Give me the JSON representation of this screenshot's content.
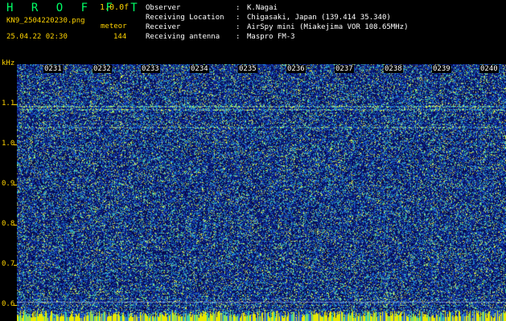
{
  "header": {
    "app_title": "H R O F F T",
    "version": "1.0.0f",
    "filename": "KN9_2504220230.png",
    "mode": "meteor",
    "datetime": "25.04.22 02:30",
    "count": "144",
    "meta": [
      {
        "key": "Observer",
        "value": "K.Nagai"
      },
      {
        "key": "Receiving Location",
        "value": "Chigasaki, Japan (139.414 35.340)"
      },
      {
        "key": "Receiver",
        "value": "AirSpy mini (Miakejima VOR 108.65MHz)"
      },
      {
        "key": "Receiving antenna",
        "value": "Maspro FM-3"
      }
    ]
  },
  "axis": {
    "unit": "kHz",
    "y_labels": [
      "1.1",
      "1.0",
      "0.9",
      "0.8",
      "0.7",
      "0.6"
    ],
    "x_labels": [
      "0231",
      "0232",
      "0233",
      "0234",
      "0235",
      "0236",
      "0237",
      "0238",
      "0239",
      "0240"
    ]
  },
  "colors": {
    "text_accent": "#ffd400",
    "title": "#00ff66",
    "background": "#08105a"
  }
}
